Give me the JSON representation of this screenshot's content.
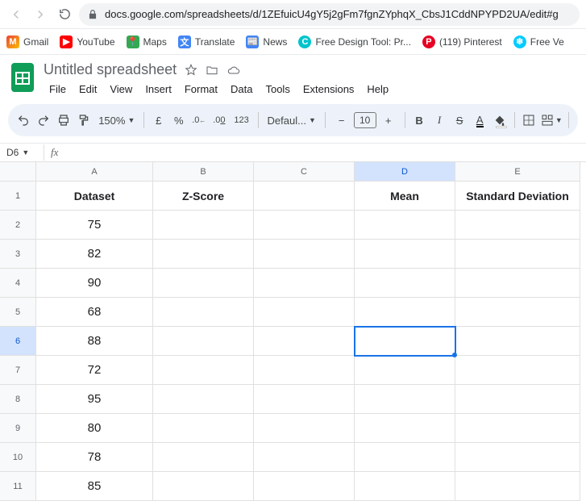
{
  "browser": {
    "url": "docs.google.com/spreadsheets/d/1ZEfuicU4gY5j2gFm7fgnZYphqX_CbsJ1CddNPYPD2UA/edit#g"
  },
  "bookmarks": [
    {
      "label": "Gmail"
    },
    {
      "label": "YouTube"
    },
    {
      "label": "Maps"
    },
    {
      "label": "Translate"
    },
    {
      "label": "News"
    },
    {
      "label": "Free Design Tool: Pr..."
    },
    {
      "label": "(119) Pinterest"
    },
    {
      "label": "Free Ve"
    }
  ],
  "doc": {
    "title": "Untitled spreadsheet"
  },
  "menu": [
    "File",
    "Edit",
    "View",
    "Insert",
    "Format",
    "Data",
    "Tools",
    "Extensions",
    "Help"
  ],
  "toolbar": {
    "zoom": "150%",
    "currency": "£",
    "percent": "%",
    "dec_dec": ".0",
    "dec_inc": ".00",
    "numfmt": "123",
    "font": "Defaul...",
    "fontsize": "10"
  },
  "namebox": "D6",
  "columns": [
    "A",
    "B",
    "C",
    "D",
    "E"
  ],
  "selected_col": "D",
  "selected_row": 6,
  "rows": [
    {
      "n": 1,
      "A": "Dataset",
      "B": "Z-Score",
      "C": "",
      "D": "Mean",
      "E": "Standard Deviation",
      "hdr": true
    },
    {
      "n": 2,
      "A": "75",
      "B": "",
      "C": "",
      "D": "",
      "E": ""
    },
    {
      "n": 3,
      "A": "82",
      "B": "",
      "C": "",
      "D": "",
      "E": ""
    },
    {
      "n": 4,
      "A": "90",
      "B": "",
      "C": "",
      "D": "",
      "E": ""
    },
    {
      "n": 5,
      "A": "68",
      "B": "",
      "C": "",
      "D": "",
      "E": ""
    },
    {
      "n": 6,
      "A": "88",
      "B": "",
      "C": "",
      "D": "",
      "E": ""
    },
    {
      "n": 7,
      "A": "72",
      "B": "",
      "C": "",
      "D": "",
      "E": ""
    },
    {
      "n": 8,
      "A": "95",
      "B": "",
      "C": "",
      "D": "",
      "E": ""
    },
    {
      "n": 9,
      "A": "80",
      "B": "",
      "C": "",
      "D": "",
      "E": ""
    },
    {
      "n": 10,
      "A": "78",
      "B": "",
      "C": "",
      "D": "",
      "E": ""
    },
    {
      "n": 11,
      "A": "85",
      "B": "",
      "C": "",
      "D": "",
      "E": ""
    }
  ]
}
